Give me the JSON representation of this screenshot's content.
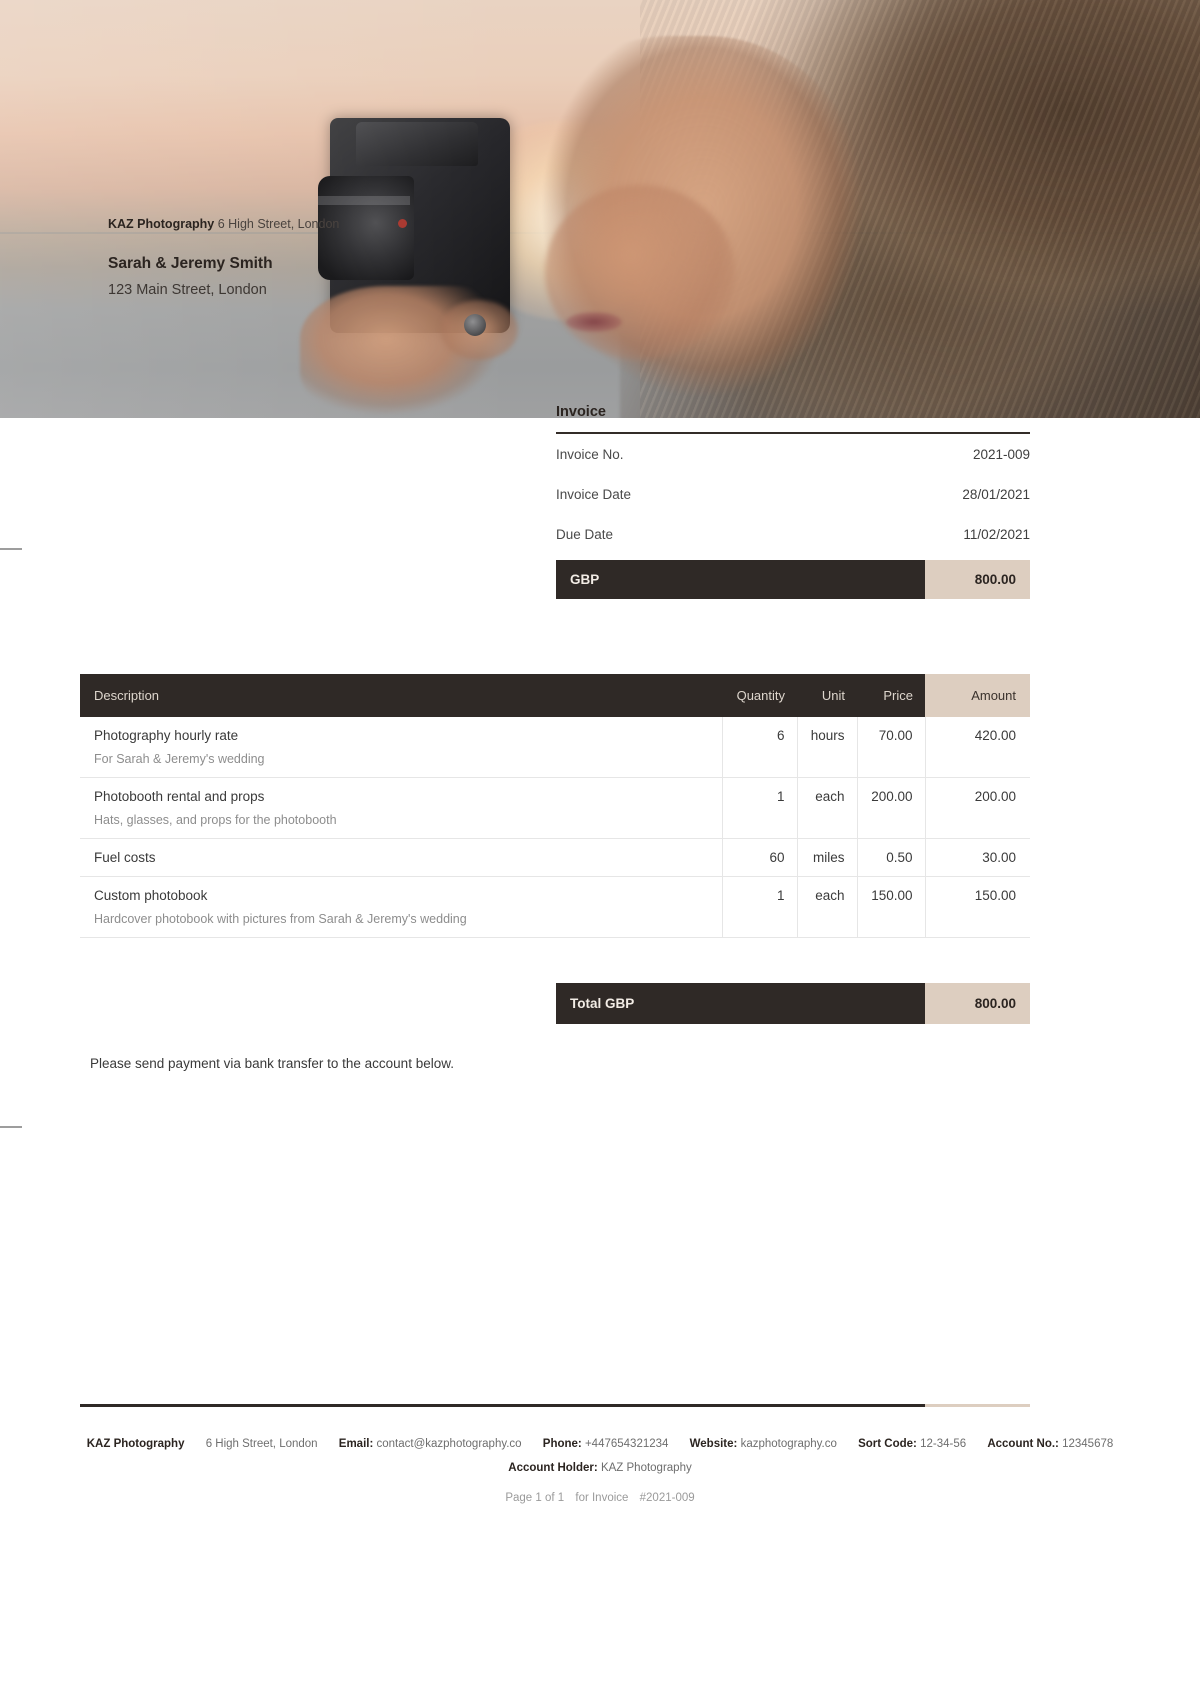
{
  "hero": {
    "company_name": "KAZ Photography",
    "company_address": "6 High Street, London",
    "client_name": "Sarah & Jeremy Smith",
    "client_address": "123 Main Street, London",
    "image_alt": "woman-photographer-with-camera-at-sunset"
  },
  "meta": {
    "title": "Invoice",
    "rows": [
      {
        "label": "Invoice No.",
        "value": "2021-009"
      },
      {
        "label": "Invoice Date",
        "value": "28/01/2021"
      },
      {
        "label": "Due Date",
        "value": "11/02/2021"
      }
    ],
    "currency_label": "GBP",
    "currency_amount": "800.00"
  },
  "table": {
    "headers": {
      "description": "Description",
      "quantity": "Quantity",
      "unit": "Unit",
      "price": "Price",
      "amount": "Amount"
    },
    "rows": [
      {
        "description": "Photography hourly rate",
        "sub": "For Sarah & Jeremy's wedding",
        "quantity": "6",
        "unit": "hours",
        "price": "70.00",
        "amount": "420.00"
      },
      {
        "description": "Photobooth rental and props",
        "sub": "Hats, glasses, and props for the photobooth",
        "quantity": "1",
        "unit": "each",
        "price": "200.00",
        "amount": "200.00"
      },
      {
        "description": "Fuel costs",
        "sub": "",
        "quantity": "60",
        "unit": "miles",
        "price": "0.50",
        "amount": "30.00"
      },
      {
        "description": "Custom photobook",
        "sub": "Hardcover photobook with pictures from Sarah & Jeremy's wedding",
        "quantity": "1",
        "unit": "each",
        "price": "150.00",
        "amount": "150.00"
      }
    ]
  },
  "total": {
    "label": "Total GBP",
    "value": "800.00"
  },
  "payment_note": "Please send payment via bank transfer to the account below.",
  "footer": {
    "company": "KAZ Photography",
    "address": "6 High Street, London",
    "email_label": "Email:",
    "email": "contact@kazphotography.co",
    "phone_label": "Phone:",
    "phone": "+447654321234",
    "website_label": "Website:",
    "website": "kazphotography.co",
    "sort_code_label": "Sort Code:",
    "sort_code": "12-34-56",
    "account_no_label": "Account No.:",
    "account_no": "12345678",
    "account_holder_label": "Account Holder:",
    "account_holder": "KAZ Photography",
    "page_text": "Page 1 of 1",
    "for_invoice_text": "for Invoice",
    "invoice_ref": "#2021-009"
  },
  "colors": {
    "dark_bar": "#2F2926",
    "accent_tan": "#DDCEC0",
    "text": "#3A3A3A",
    "muted": "#8D8D8D"
  }
}
